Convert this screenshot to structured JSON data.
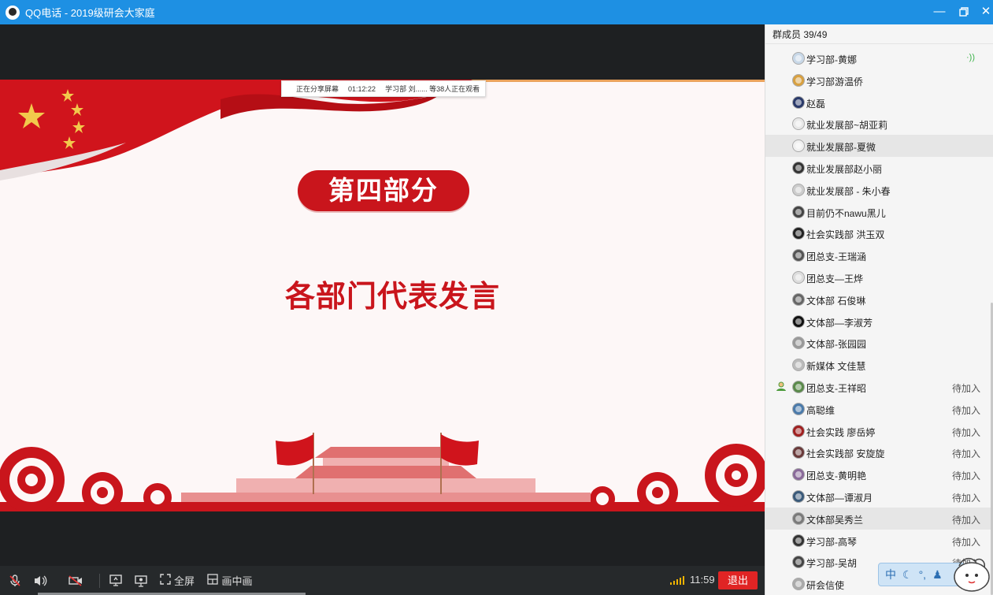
{
  "window": {
    "title": "QQ电话 - 2019级研会大家庭",
    "minimize_icon": "minimize-icon",
    "restore_icon": "restore-icon",
    "close_icon": "close-icon"
  },
  "share_bar": {
    "status": "正在分享屏幕",
    "duration": "01:12:22",
    "viewers": "学习部  刘...... 等38人正在观看"
  },
  "slide": {
    "section_title": "第四部分",
    "headline": "各部门代表发言",
    "colors": {
      "red": "#c9151c",
      "background": "#fdf7f7",
      "gold": "#f2c94c"
    }
  },
  "controls": {
    "fullscreen_label": "全屏",
    "pip_label": "画中画",
    "time": "11:59",
    "exit_label": "退出",
    "icons": [
      "mic-muted-icon",
      "speaker-icon",
      "camera-off-icon",
      "screen-share-icon",
      "presentation-icon",
      "fullscreen-icon",
      "pip-icon",
      "signal-icon"
    ]
  },
  "members": {
    "header": "群成员 39/49",
    "items": [
      {
        "name": "学习部-黄娜",
        "status": "",
        "speaking": true,
        "color": "#c8d8e8"
      },
      {
        "name": "学习部游温侨",
        "status": "",
        "color": "#d8a040"
      },
      {
        "name": "赵磊",
        "status": "",
        "color": "#2a3a6a"
      },
      {
        "name": "就业发展部~胡亚莉",
        "status": "",
        "color": "#e8e8e8"
      },
      {
        "name": "就业发展部-夏微",
        "status": "",
        "color": "#f0f0f0",
        "highlight": true
      },
      {
        "name": "就业发展部赵小丽",
        "status": "",
        "color": "#333333"
      },
      {
        "name": "就业发展部 - 朱小春",
        "status": "",
        "color": "#cccccc"
      },
      {
        "name": "目前仍不nawu黑儿",
        "status": "",
        "color": "#444444"
      },
      {
        "name": "社会实践部 洪玉双",
        "status": "",
        "color": "#222222"
      },
      {
        "name": "团总支-王瑞涵",
        "status": "",
        "color": "#555555"
      },
      {
        "name": "团总支—王烨",
        "status": "",
        "color": "#dddddd"
      },
      {
        "name": "文体部 石俊琳",
        "status": "",
        "color": "#666666"
      },
      {
        "name": "文体部—李淑芳",
        "status": "",
        "color": "#111111"
      },
      {
        "name": "文体部-张园园",
        "status": "",
        "color": "#999999"
      },
      {
        "name": "新媒体 文佳慧",
        "status": "",
        "color": "#bbbbbb"
      },
      {
        "name": "团总支-王祥昭",
        "status": "待加入",
        "host": true,
        "color": "#5a8a4a"
      },
      {
        "name": "高聪维",
        "status": "待加入",
        "color": "#4a7aaa"
      },
      {
        "name": "社会实践 廖岳婷",
        "status": "待加入",
        "color": "#a02020"
      },
      {
        "name": "社会实践部 安旋旋",
        "status": "待加入",
        "color": "#6a3a3a"
      },
      {
        "name": "团总支-黄明艳",
        "status": "待加入",
        "color": "#8a6a9a"
      },
      {
        "name": "文体部—谭淑月",
        "status": "待加入",
        "color": "#3a5a7a"
      },
      {
        "name": "文体部吴秀兰",
        "status": "待加入",
        "color": "#7a7a7a",
        "highlight": true
      },
      {
        "name": "学习部-高琴",
        "status": "待加入",
        "color": "#333333"
      },
      {
        "name": "学习部-吴胡",
        "status": "待加入",
        "color": "#444444"
      },
      {
        "name": "研会信使",
        "status": "",
        "color": "#aaaaaa"
      }
    ]
  },
  "ime": {
    "label": "中"
  }
}
